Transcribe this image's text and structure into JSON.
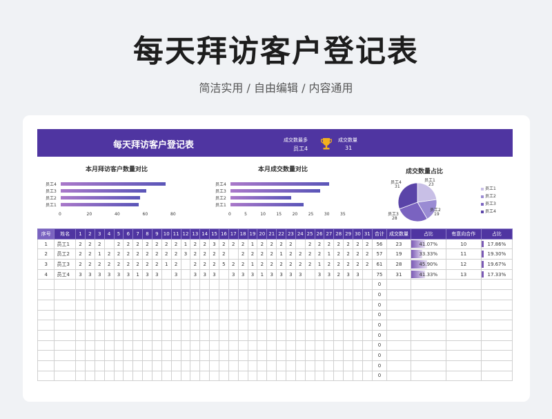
{
  "page": {
    "title": "每天拜访客户登记表",
    "subtitle": "简洁实用 / 自由编辑 / 内容通用"
  },
  "banner": {
    "title": "每天拜访客户登记表",
    "most_label": "成交数最多",
    "most_value": "员工4",
    "count_label": "成交数量",
    "count_value": "31",
    "trophy_color": "#f2b01e"
  },
  "colors": {
    "accent": "#4f35a1",
    "pie": [
      "#c8bfe6",
      "#9a8bd3",
      "#7a63c0",
      "#5a44a8"
    ]
  },
  "chart_data": [
    {
      "type": "bar",
      "title": "本月拜访客户数量对比",
      "categories": [
        "员工4",
        "员工3",
        "员工2",
        "员工1"
      ],
      "values": [
        75,
        61,
        57,
        56
      ],
      "xticks": [
        "0",
        "20",
        "40",
        "60",
        "80"
      ],
      "xlim": [
        0,
        80
      ]
    },
    {
      "type": "bar",
      "title": "本月成交数量对比",
      "categories": [
        "员工4",
        "员工3",
        "员工2",
        "员工1"
      ],
      "values": [
        31,
        28,
        19,
        23
      ],
      "xticks": [
        "0",
        "5",
        "10",
        "15",
        "20",
        "25",
        "30",
        "35"
      ],
      "xlim": [
        0,
        35
      ]
    },
    {
      "type": "pie",
      "title": "成交数量占比",
      "categories": [
        "员工1",
        "员工2",
        "员工3",
        "员工4"
      ],
      "values": [
        23,
        19,
        28,
        31
      ],
      "labels": [
        {
          "name": "员工1",
          "value": "23"
        },
        {
          "name": "员工2",
          "value": "19"
        },
        {
          "name": "员工3",
          "value": "28"
        },
        {
          "name": "员工4",
          "value": "31"
        }
      ],
      "legend": [
        "员工1",
        "员工2",
        "员工3",
        "员工4"
      ],
      "legend_position": "right"
    }
  ],
  "table": {
    "headers": [
      "序号",
      "姓名",
      "1",
      "2",
      "3",
      "4",
      "5",
      "6",
      "7",
      "8",
      "9",
      "10",
      "11",
      "12",
      "13",
      "14",
      "15",
      "16",
      "17",
      "18",
      "19",
      "20",
      "21",
      "22",
      "23",
      "24",
      "25",
      "26",
      "27",
      "28",
      "29",
      "30",
      "31",
      "合计",
      "成交数量",
      "占比",
      "有意向合作",
      "占比"
    ],
    "rows": [
      {
        "no": "1",
        "name": "员工1",
        "days": [
          "2",
          "2",
          "2",
          "",
          "2",
          "2",
          "2",
          "2",
          "2",
          "2",
          "2",
          "1",
          "2",
          "2",
          "3",
          "2",
          "2",
          "2",
          "1",
          "2",
          "2",
          "2",
          "2",
          "",
          "2",
          "2",
          "2",
          "2",
          "2",
          "2",
          "2"
        ],
        "total": "56",
        "deals": "23",
        "ratio": "41.07%",
        "ratio_value": 0.4107,
        "intent": "10",
        "intent_ratio": "17.86%",
        "intent_value": 0.1786
      },
      {
        "no": "2",
        "name": "员工2",
        "days": [
          "2",
          "2",
          "1",
          "2",
          "2",
          "2",
          "2",
          "2",
          "2",
          "2",
          "2",
          "3",
          "2",
          "2",
          "2",
          "2",
          "",
          "2",
          "2",
          "2",
          "2",
          "1",
          "2",
          "2",
          "2",
          "2",
          "1",
          "2",
          "2",
          "2",
          "2"
        ],
        "total": "57",
        "deals": "19",
        "ratio": "33.33%",
        "ratio_value": 0.3333,
        "intent": "11",
        "intent_ratio": "19.30%",
        "intent_value": 0.193
      },
      {
        "no": "3",
        "name": "员工3",
        "days": [
          "2",
          "2",
          "2",
          "2",
          "2",
          "2",
          "2",
          "2",
          "2",
          "1",
          "2",
          "",
          "2",
          "2",
          "2",
          "5",
          "2",
          "2",
          "1",
          "2",
          "2",
          "2",
          "2",
          "2",
          "2",
          "1",
          "2",
          "2",
          "2",
          "2",
          "2"
        ],
        "total": "61",
        "deals": "28",
        "ratio": "45.90%",
        "ratio_value": 0.459,
        "intent": "12",
        "intent_ratio": "19.67%",
        "intent_value": 0.1967
      },
      {
        "no": "4",
        "name": "员工4",
        "days": [
          "3",
          "3",
          "3",
          "3",
          "3",
          "3",
          "1",
          "3",
          "3",
          "",
          "3",
          "",
          "3",
          "3",
          "3",
          "",
          "3",
          "3",
          "3",
          "1",
          "3",
          "3",
          "3",
          "3",
          "",
          "3",
          "3",
          "2",
          "3",
          "3",
          ""
        ],
        "total": "75",
        "deals": "31",
        "ratio": "41.33%",
        "ratio_value": 0.4133,
        "intent": "13",
        "intent_ratio": "17.33%",
        "intent_value": 0.1733
      }
    ],
    "empty_total": "0",
    "empty_rows": 10
  }
}
